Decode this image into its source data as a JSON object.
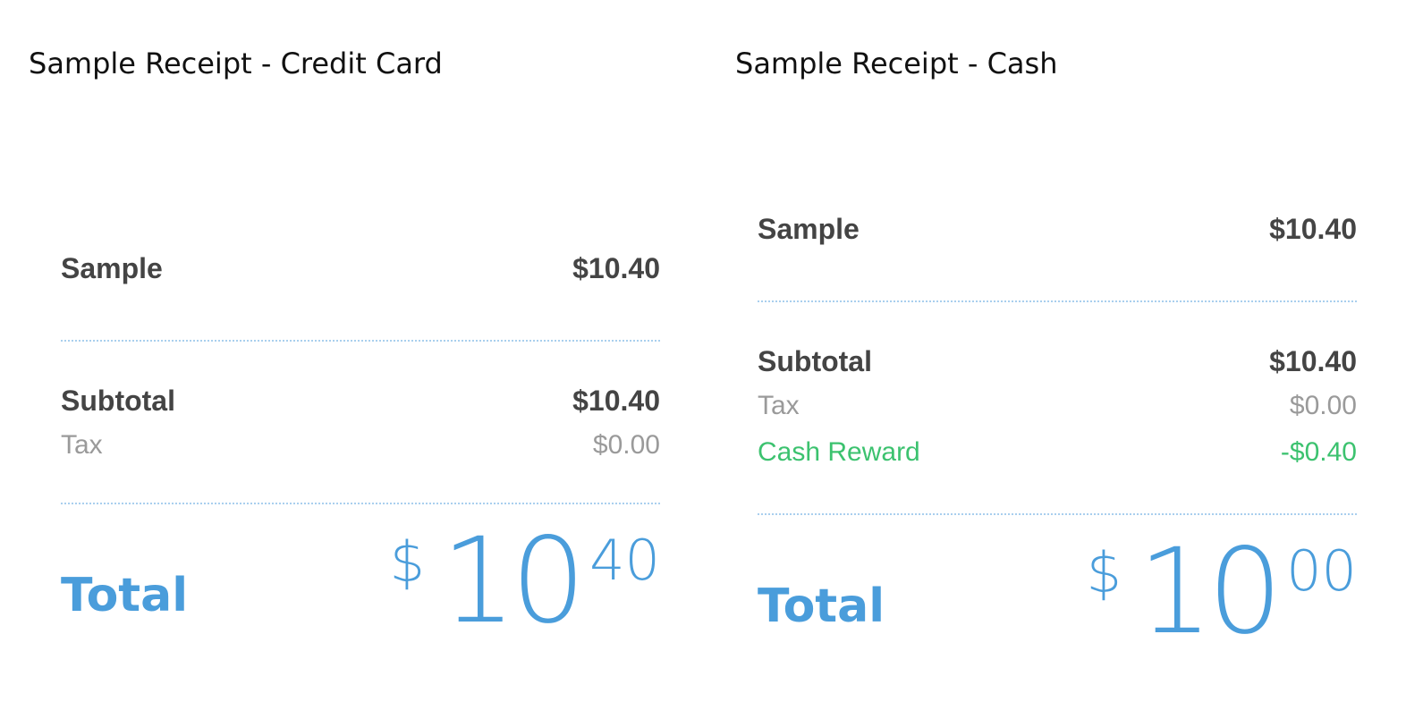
{
  "headings": {
    "credit": "Sample Receipt - Credit Card",
    "cash": "Sample Receipt - Cash"
  },
  "credit_receipt": {
    "item_name": "Sample",
    "item_price": "$10.40",
    "subtotal_label": "Subtotal",
    "subtotal_value": "$10.40",
    "tax_label": "Tax",
    "tax_value": "$0.00",
    "total_label": "Total",
    "total_currency": "$",
    "total_dollars": "10",
    "total_cents": "40"
  },
  "cash_receipt": {
    "item_name": "Sample",
    "item_price": "$10.40",
    "subtotal_label": "Subtotal",
    "subtotal_value": "$10.40",
    "tax_label": "Tax",
    "tax_value": "$0.00",
    "reward_label": "Cash Reward",
    "reward_value": "-$0.40",
    "total_label": "Total",
    "total_currency": "$",
    "total_dollars": "10",
    "total_cents": "00"
  },
  "colors": {
    "accent_blue": "#4a9ddb",
    "reward_green": "#3cc26f",
    "divider_blue": "#a9cfee",
    "muted_gray": "#9a9a9a",
    "text_dark": "#444444"
  }
}
